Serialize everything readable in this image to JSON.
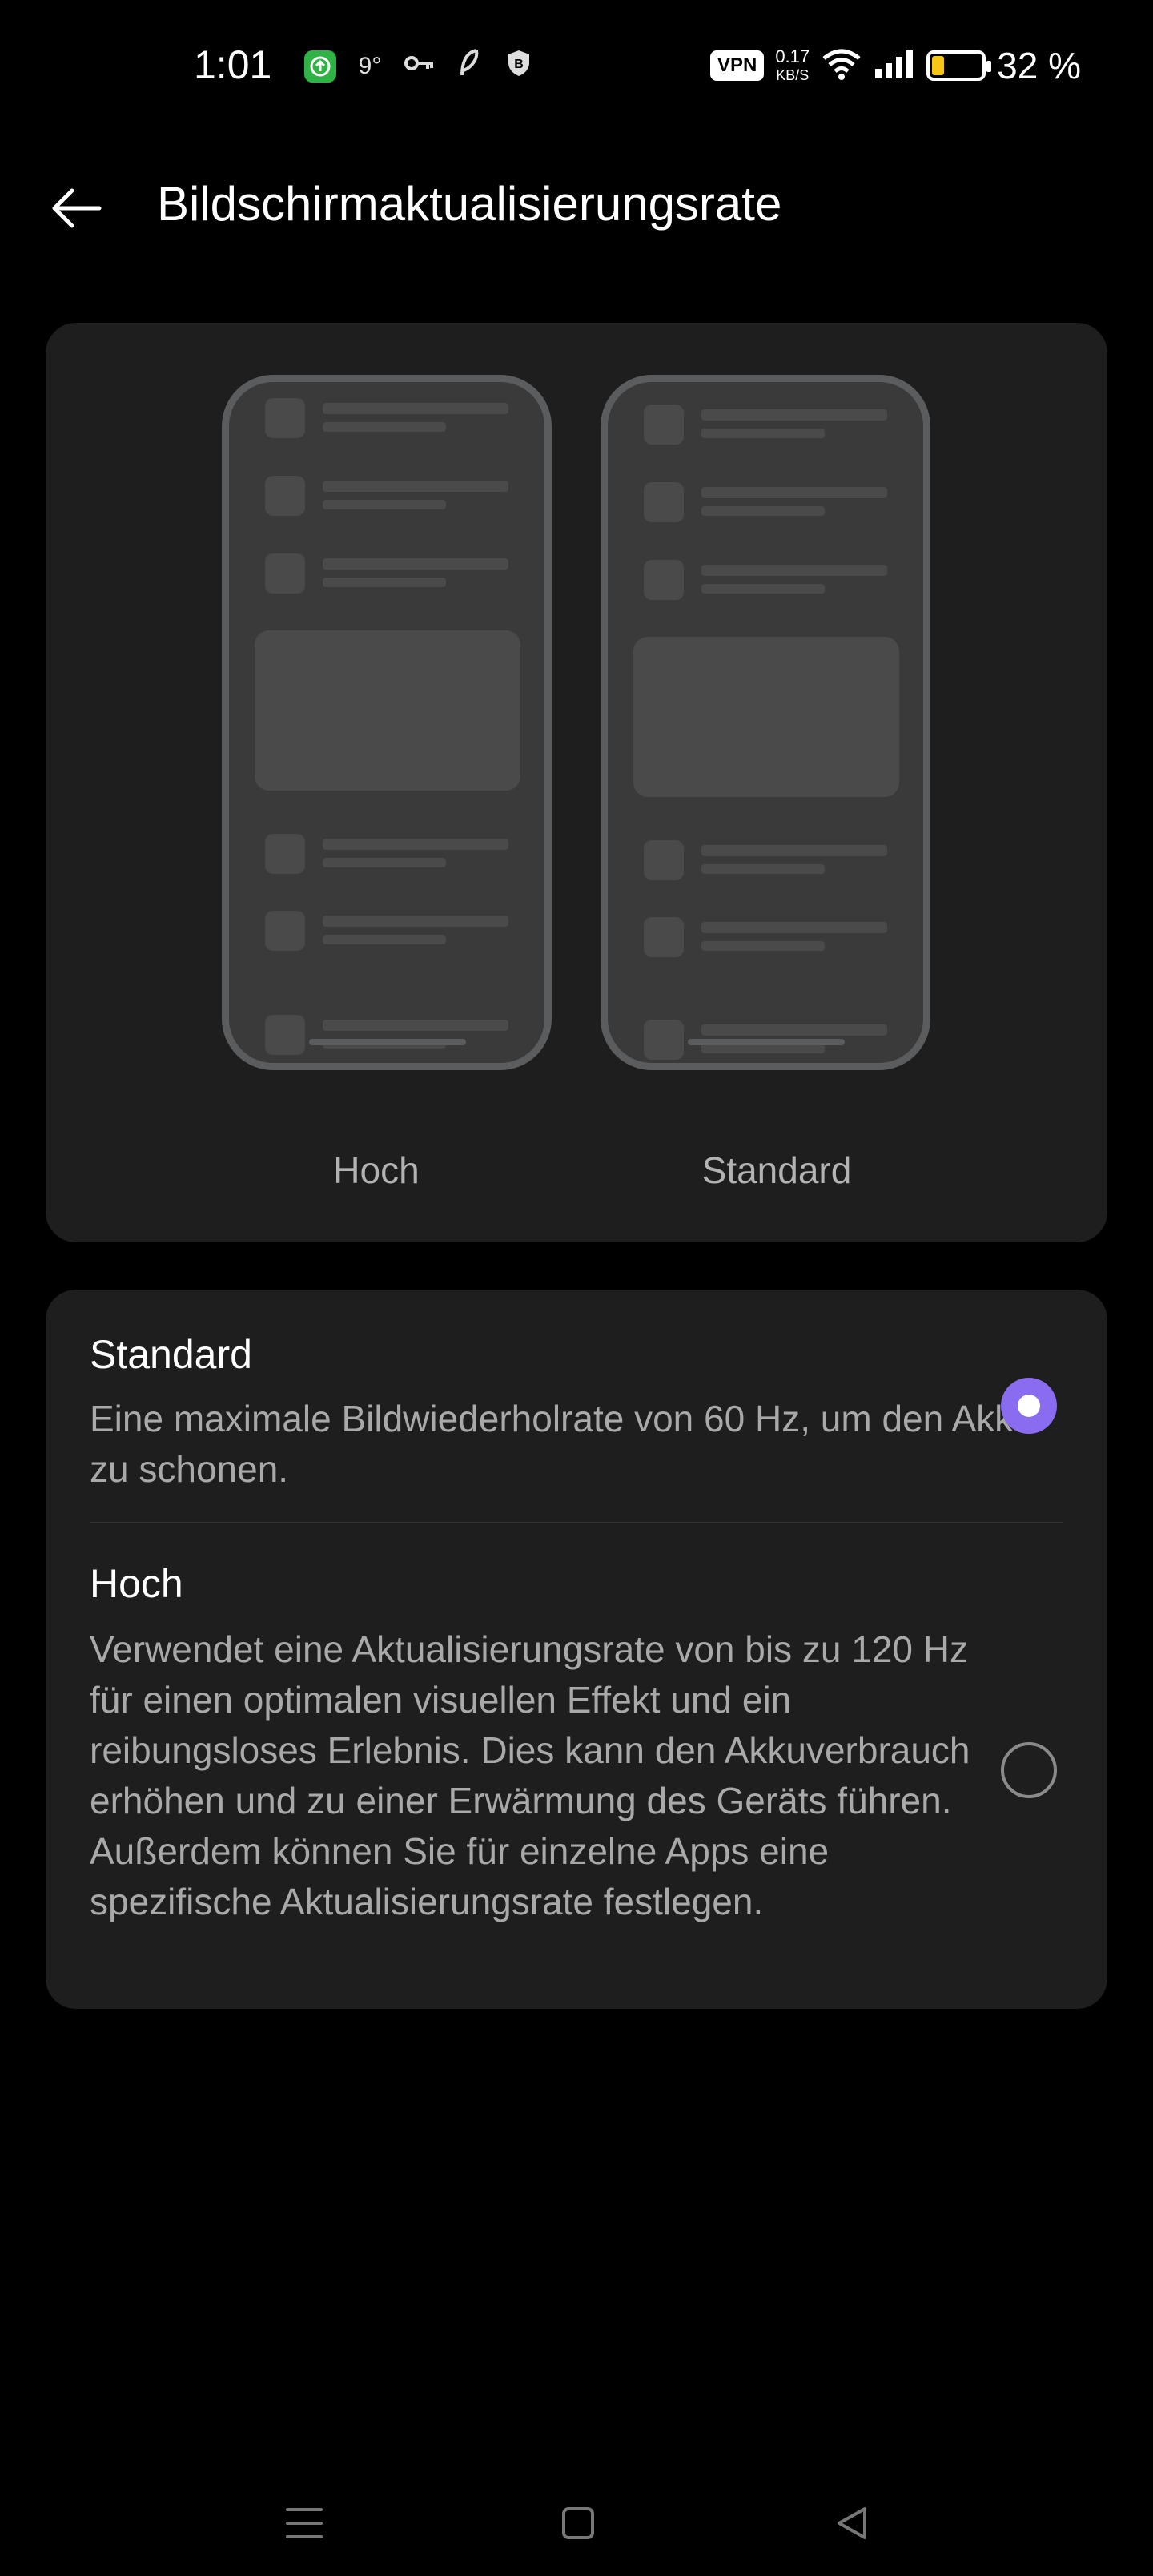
{
  "status_bar": {
    "time": "1:01",
    "left_icons": [
      "app-notification-icon",
      "weather-icon",
      "key-icon",
      "feather-icon",
      "shield-icon"
    ],
    "weather_text": "9°",
    "vpn_label": "VPN",
    "net_speed_value": "0.17",
    "net_speed_unit": "KB/S",
    "battery_percent_text": "32 %",
    "battery_level": 0.32,
    "battery_color": "#f5c518"
  },
  "header": {
    "back_icon": "back-arrow-icon",
    "title": "Bildschirmaktualisierungsrate"
  },
  "preview": {
    "left_label": "Hoch",
    "right_label": "Standard"
  },
  "options": [
    {
      "title": "Standard",
      "description": "Eine maximale Bildwiederholrate von 60 Hz, um den Akku zu schonen.",
      "selected": true
    },
    {
      "title": "Hoch",
      "description": "Verwendet eine Aktualisierungsrate von bis zu 120 Hz für einen optimalen visuellen Effekt und ein reibungsloses Erlebnis. Dies kann den Akkuverbrauch erhöhen und zu einer Erwärmung des Geräts führen. Außerdem können Sie für einzelne Apps eine spezifische Aktualisierungsrate festlegen.",
      "selected": false
    }
  ],
  "nav_bar": {
    "icons": [
      "menu-icon",
      "home-icon",
      "back-icon"
    ]
  },
  "colors": {
    "accent": "#8a6cf0",
    "background": "#000000",
    "card": "#1e1e1f"
  }
}
